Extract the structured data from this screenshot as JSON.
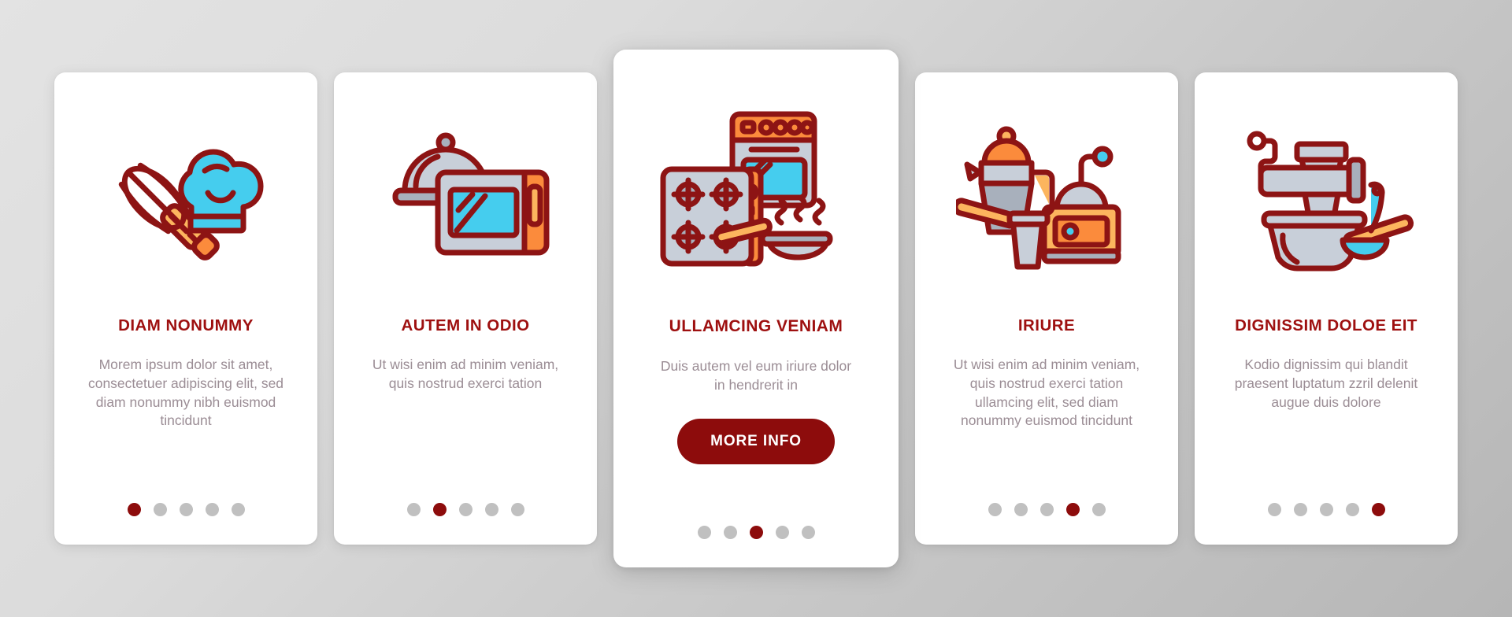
{
  "background": {
    "gradient_from": "#e3e3e3",
    "gradient_to": "#b6b6b6"
  },
  "theme": {
    "accent_red": "#8d0c0c",
    "title_red": "#9e1010",
    "body_text": "#9b8d95",
    "dot_inactive": "#c0c0c0",
    "card_bg": "#ffffff",
    "icon_stroke": "#8d1414",
    "icon_gray": "#c8cfd9",
    "icon_gray_dark": "#a8b0bc",
    "icon_cyan": "#45cdee",
    "icon_orange": "#fb8b3c",
    "icon_orange_light": "#fcb55e"
  },
  "cards": [
    {
      "icon": "whisk-chef-hat-icon",
      "title": "DIAM NONUMMY",
      "description": "Morem ipsum dolor sit amet, consectetuer adipiscing elit, sed diam nonummy nibh euismod tincidunt",
      "featured": false,
      "cta": null,
      "dots_total": 5,
      "dot_active_index": 0
    },
    {
      "icon": "cloche-microwave-icon",
      "title": "AUTEM IN ODIO",
      "description": "Ut wisi enim ad minim veniam, quis nostrud exerci tation",
      "featured": false,
      "cta": null,
      "dots_total": 5,
      "dot_active_index": 1
    },
    {
      "icon": "oven-stovetop-pan-icon",
      "title": "ULLAMCING VENIAM",
      "description": "Duis autem vel eum iriure dolor in hendrerit in",
      "featured": true,
      "cta": "MORE INFO",
      "dots_total": 5,
      "dot_active_index": 2
    },
    {
      "icon": "coffee-pot-grinder-icon",
      "title": "IRIURE",
      "description": "Ut wisi enim ad minim veniam, quis nostrud exerci tation ullamcing elit, sed diam nonummy euismod tincidunt",
      "featured": false,
      "cta": null,
      "dots_total": 5,
      "dot_active_index": 3
    },
    {
      "icon": "meat-grinder-ladle-icon",
      "title": "DIGNISSIM DOLOE EIT",
      "description": "Kodio dignissim qui blandit praesent luptatum zzril delenit augue duis dolore",
      "featured": false,
      "cta": null,
      "dots_total": 5,
      "dot_active_index": 4
    }
  ]
}
